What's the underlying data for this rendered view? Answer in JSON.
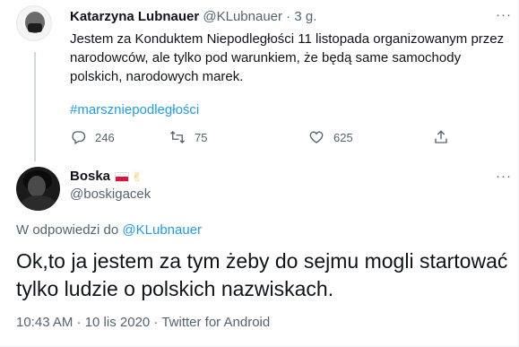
{
  "parent_tweet": {
    "author_name": "Katarzyna Lubnauer",
    "handle": "@KLubnauer",
    "separator": "·",
    "time": "3 g.",
    "text": "Jestem za Konduktem Niepodległości 11 listopada organizowanym przez narodowców, ale tylko pod warunkiem, że będą same samochody polskich, narodowych marek.",
    "hashtag": "#marszniepodległości",
    "reply_count": "246",
    "retweet_count": "75",
    "like_count": "625",
    "avatar_icon": "profile-photo",
    "more_icon": "more-icon"
  },
  "reply_tweet": {
    "author_name": "Boska",
    "name_emoji_flag": "poland-flag-icon",
    "name_emoji_victory": "✌",
    "handle": "@boskigacek",
    "in_reply_prefix": "W odpowiedzi do",
    "in_reply_handle": "@KLubnauer",
    "text": "Ok,to ja jestem za tym żeby do sejmu mogli startować tylko ludzie o polskich nazwiskach.",
    "timestamp": "10:43 AM · 10 lis 2020 · Twitter for Android"
  },
  "colors": {
    "accent": "#1d9bf0",
    "secondary_text": "#536471",
    "primary_text": "#0f1419",
    "thread_line": "#cfd9de"
  }
}
